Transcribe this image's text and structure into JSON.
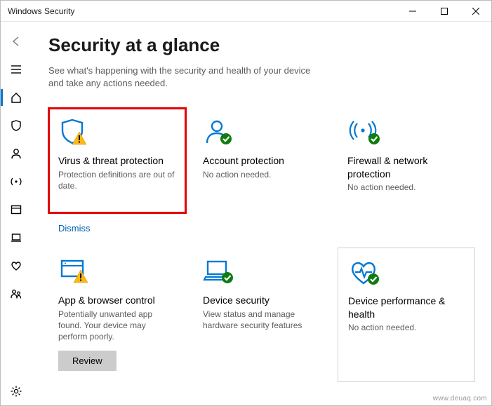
{
  "window": {
    "title": "Windows Security"
  },
  "header": {
    "title": "Security at a glance",
    "subtitle": "See what's happening with the security and health of your device and take any actions needed."
  },
  "cards": {
    "virus": {
      "title": "Virus & threat protection",
      "sub": "Protection definitions are out of date."
    },
    "account": {
      "title": "Account protection",
      "sub": "No action needed."
    },
    "firewall": {
      "title": "Firewall & network protection",
      "sub": "No action needed."
    },
    "app": {
      "title": "App & browser control",
      "sub": "Potentially unwanted app found. Your device may perform poorly."
    },
    "device": {
      "title": "Device security",
      "sub": "View status and manage hardware security features"
    },
    "perf": {
      "title": "Device performance & health",
      "sub": "No action needed."
    }
  },
  "actions": {
    "dismiss": "Dismiss",
    "review": "Review"
  },
  "watermark": "www.deuaq.com",
  "colors": {
    "accent": "#0078d4",
    "ok": "#107c10",
    "warn": "#fdb813",
    "highlight": "#e40000"
  }
}
